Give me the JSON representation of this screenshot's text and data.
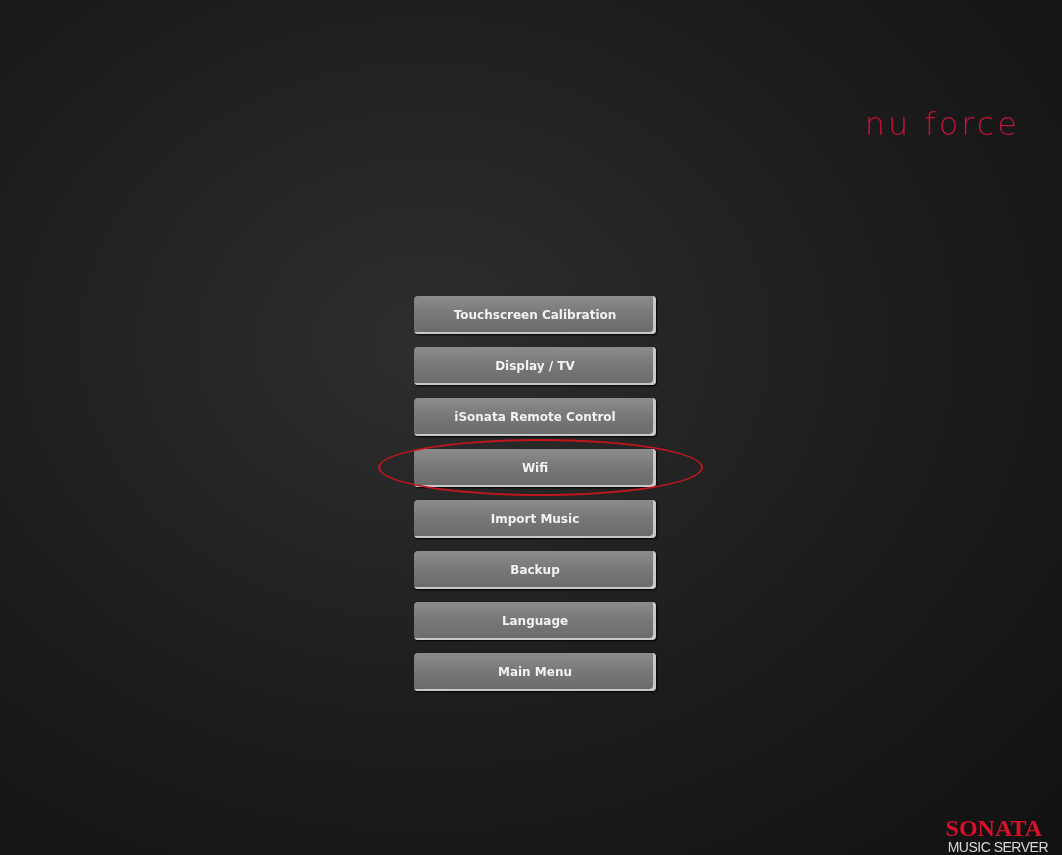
{
  "logo": "nu force",
  "menu": [
    {
      "label": "Touchscreen Calibration",
      "highlighted": false
    },
    {
      "label": "Display / TV",
      "highlighted": false
    },
    {
      "label": "iSonata Remote Control",
      "highlighted": false
    },
    {
      "label": "Wifi",
      "highlighted": true
    },
    {
      "label": "Import Music",
      "highlighted": false
    },
    {
      "label": "Backup",
      "highlighted": false
    },
    {
      "label": "Language",
      "highlighted": false
    },
    {
      "label": "Main Menu",
      "highlighted": false
    }
  ],
  "brand": {
    "name": "SONATA",
    "subtitle": "MUSIC SERVER"
  }
}
